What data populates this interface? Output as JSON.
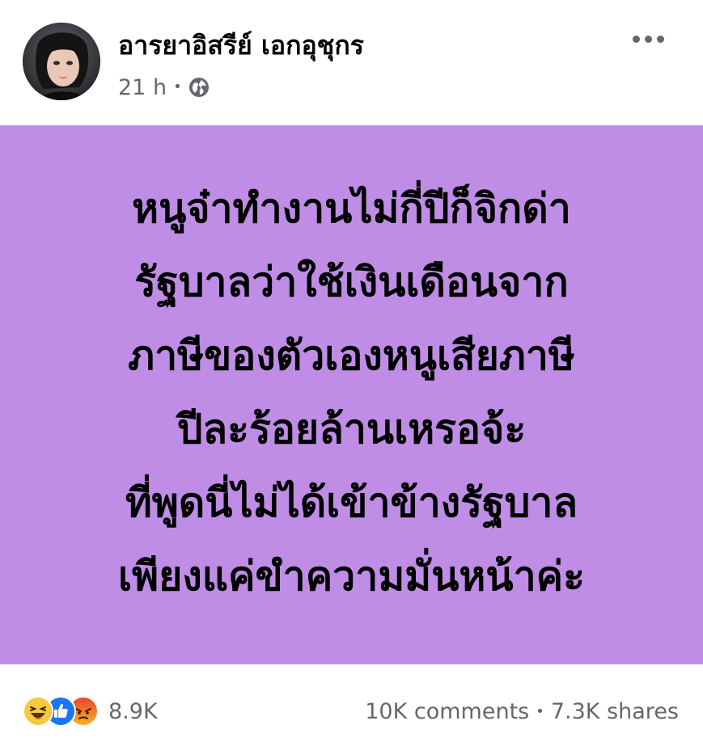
{
  "post": {
    "author": {
      "name": "อารยาอิสรีย์ เอกอุชุกร",
      "avatar_icon": "profile-photo"
    },
    "timestamp": "21 h",
    "separator": "•",
    "audience_icon": "globe-icon",
    "more_icon": "more-options-icon",
    "background_color": "#bf8de6",
    "text_lines": [
      "หนูจ๋าทำงานไม่กี่ปีก็จิกด่า",
      "รัฐบาลว่าใช้เงินเดือนจาก",
      "ภาษีของตัวเองหนูเสียภาษี",
      "ปีละร้อยล้านเหรอจ้ะ",
      "ที่พูดนี่ไม่ได้เข้าข้างรัฐบาล",
      "เพียงแค่ขำความมั่นหน้าค่ะ"
    ]
  },
  "footer": {
    "reactions": [
      "haha",
      "like",
      "angry"
    ],
    "reaction_count": "8.9K",
    "comments": "10K comments",
    "separator": "•",
    "shares": "7.3K shares"
  }
}
